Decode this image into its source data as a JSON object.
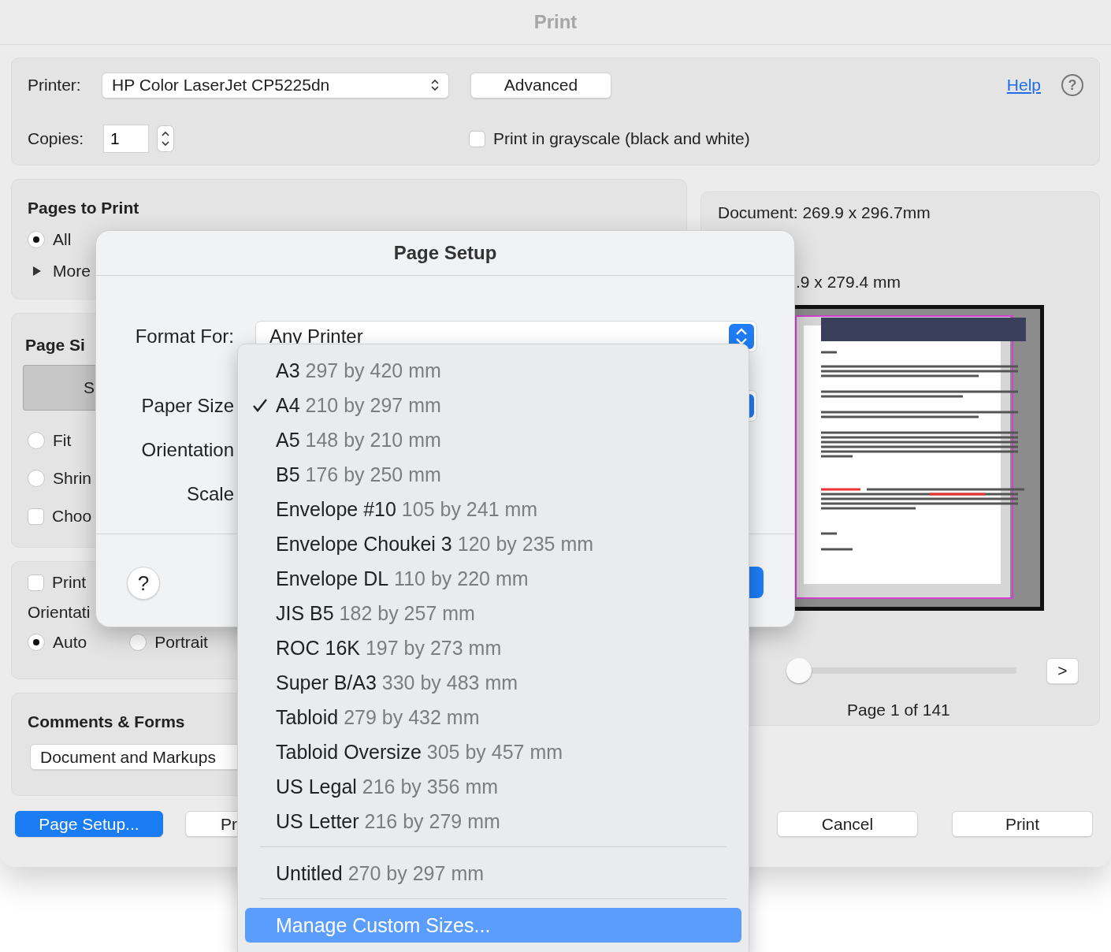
{
  "window": {
    "title": "Print"
  },
  "printer": {
    "label": "Printer:",
    "value": "HP Color LaserJet CP5225dn"
  },
  "advanced_button": "Advanced",
  "help_link": "Help",
  "help_button": "?",
  "copies": {
    "label": "Copies:",
    "value": "1"
  },
  "grayscale": {
    "label": "Print in grayscale (black and white)",
    "checked": false
  },
  "pages_to_print": {
    "title": "Pages to Print",
    "options": [
      {
        "label": "All",
        "selected": true
      }
    ],
    "more": {
      "label": "More",
      "expanded": false
    }
  },
  "page_size": {
    "title": "Page Si",
    "segment": {
      "label": "S",
      "selected": true
    },
    "options": [
      {
        "kind": "radio",
        "label": "Fit",
        "selected": false
      },
      {
        "kind": "radio",
        "label": "Shrin",
        "selected": false
      },
      {
        "kind": "checkbox",
        "label": "Choo",
        "checked": false
      }
    ]
  },
  "orientation": {
    "print_checkbox": {
      "label": "Print",
      "checked": false
    },
    "title": "Orientati",
    "options": [
      {
        "label": "Auto",
        "selected": true
      },
      {
        "label": "Portrait",
        "selected": false
      }
    ]
  },
  "comments_forms": {
    "title": "Comments & Forms",
    "value": "Document and Markups"
  },
  "preview": {
    "document_size": "Document: 269.9 x 296.7mm",
    "paper_size": ".9 x 279.4 mm",
    "slider": {
      "level": 0
    },
    "next_button": ">",
    "page_label": "Page 1 of 141"
  },
  "buttons": [
    {
      "label": "Page Setup...",
      "kind": "primary"
    },
    {
      "label": "Pr",
      "kind": "normal"
    },
    {
      "label": "Cancel",
      "kind": "normal"
    },
    {
      "label": "Print",
      "kind": "normal"
    }
  ],
  "page_setup": {
    "title": "Page Setup",
    "fields": [
      {
        "label": "Format For:",
        "value": "Any Printer"
      },
      {
        "label": "Paper Size"
      },
      {
        "label": "Orientation"
      },
      {
        "label": "Scale"
      }
    ],
    "help_button": "?"
  },
  "paper_menu": {
    "groups": [
      [
        {
          "name": "A3",
          "size": "297 by 420 mm",
          "checked": false,
          "selected": false
        },
        {
          "name": "A4",
          "size": "210 by 297 mm",
          "checked": true,
          "selected": false
        },
        {
          "name": "A5",
          "size": "148 by 210 mm",
          "checked": false,
          "selected": false
        },
        {
          "name": "B5",
          "size": "176 by 250 mm",
          "checked": false,
          "selected": false
        },
        {
          "name": "Envelope #10",
          "size": "105 by 241 mm",
          "checked": false,
          "selected": false
        },
        {
          "name": "Envelope Choukei 3",
          "size": "120 by 235 mm",
          "checked": false,
          "selected": false
        },
        {
          "name": "Envelope DL",
          "size": "110 by 220 mm",
          "checked": false,
          "selected": false
        },
        {
          "name": "JIS B5",
          "size": "182 by 257 mm",
          "checked": false,
          "selected": false
        },
        {
          "name": "ROC 16K",
          "size": "197 by 273 mm",
          "checked": false,
          "selected": false
        },
        {
          "name": "Super B/A3",
          "size": "330 by 483 mm",
          "checked": false,
          "selected": false
        },
        {
          "name": "Tabloid",
          "size": "279 by 432 mm",
          "checked": false,
          "selected": false
        },
        {
          "name": "Tabloid Oversize",
          "size": "305 by 457 mm",
          "checked": false,
          "selected": false
        },
        {
          "name": "US Legal",
          "size": "216 by 356 mm",
          "checked": false,
          "selected": false
        },
        {
          "name": "US Letter",
          "size": "216 by 279 mm",
          "checked": false,
          "selected": false
        }
      ],
      [
        {
          "name": "Untitled",
          "size": "270 by 297 mm",
          "checked": false,
          "selected": false
        }
      ],
      [
        {
          "name": "Manage Custom Sizes...",
          "checked": false,
          "selected": true
        }
      ]
    ]
  }
}
